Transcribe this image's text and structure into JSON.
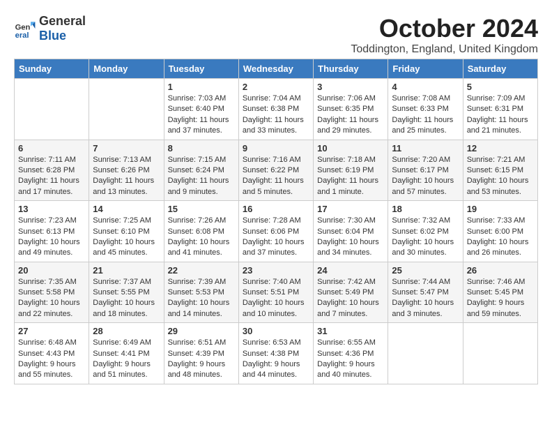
{
  "header": {
    "logo_general": "General",
    "logo_blue": "Blue",
    "title": "October 2024",
    "location": "Toddington, England, United Kingdom"
  },
  "days_of_week": [
    "Sunday",
    "Monday",
    "Tuesday",
    "Wednesday",
    "Thursday",
    "Friday",
    "Saturday"
  ],
  "weeks": [
    [
      {
        "day": "",
        "info": ""
      },
      {
        "day": "",
        "info": ""
      },
      {
        "day": "1",
        "info": "Sunrise: 7:03 AM\nSunset: 6:40 PM\nDaylight: 11 hours and 37 minutes."
      },
      {
        "day": "2",
        "info": "Sunrise: 7:04 AM\nSunset: 6:38 PM\nDaylight: 11 hours and 33 minutes."
      },
      {
        "day": "3",
        "info": "Sunrise: 7:06 AM\nSunset: 6:35 PM\nDaylight: 11 hours and 29 minutes."
      },
      {
        "day": "4",
        "info": "Sunrise: 7:08 AM\nSunset: 6:33 PM\nDaylight: 11 hours and 25 minutes."
      },
      {
        "day": "5",
        "info": "Sunrise: 7:09 AM\nSunset: 6:31 PM\nDaylight: 11 hours and 21 minutes."
      }
    ],
    [
      {
        "day": "6",
        "info": "Sunrise: 7:11 AM\nSunset: 6:28 PM\nDaylight: 11 hours and 17 minutes."
      },
      {
        "day": "7",
        "info": "Sunrise: 7:13 AM\nSunset: 6:26 PM\nDaylight: 11 hours and 13 minutes."
      },
      {
        "day": "8",
        "info": "Sunrise: 7:15 AM\nSunset: 6:24 PM\nDaylight: 11 hours and 9 minutes."
      },
      {
        "day": "9",
        "info": "Sunrise: 7:16 AM\nSunset: 6:22 PM\nDaylight: 11 hours and 5 minutes."
      },
      {
        "day": "10",
        "info": "Sunrise: 7:18 AM\nSunset: 6:19 PM\nDaylight: 11 hours and 1 minute."
      },
      {
        "day": "11",
        "info": "Sunrise: 7:20 AM\nSunset: 6:17 PM\nDaylight: 10 hours and 57 minutes."
      },
      {
        "day": "12",
        "info": "Sunrise: 7:21 AM\nSunset: 6:15 PM\nDaylight: 10 hours and 53 minutes."
      }
    ],
    [
      {
        "day": "13",
        "info": "Sunrise: 7:23 AM\nSunset: 6:13 PM\nDaylight: 10 hours and 49 minutes."
      },
      {
        "day": "14",
        "info": "Sunrise: 7:25 AM\nSunset: 6:10 PM\nDaylight: 10 hours and 45 minutes."
      },
      {
        "day": "15",
        "info": "Sunrise: 7:26 AM\nSunset: 6:08 PM\nDaylight: 10 hours and 41 minutes."
      },
      {
        "day": "16",
        "info": "Sunrise: 7:28 AM\nSunset: 6:06 PM\nDaylight: 10 hours and 37 minutes."
      },
      {
        "day": "17",
        "info": "Sunrise: 7:30 AM\nSunset: 6:04 PM\nDaylight: 10 hours and 34 minutes."
      },
      {
        "day": "18",
        "info": "Sunrise: 7:32 AM\nSunset: 6:02 PM\nDaylight: 10 hours and 30 minutes."
      },
      {
        "day": "19",
        "info": "Sunrise: 7:33 AM\nSunset: 6:00 PM\nDaylight: 10 hours and 26 minutes."
      }
    ],
    [
      {
        "day": "20",
        "info": "Sunrise: 7:35 AM\nSunset: 5:58 PM\nDaylight: 10 hours and 22 minutes."
      },
      {
        "day": "21",
        "info": "Sunrise: 7:37 AM\nSunset: 5:55 PM\nDaylight: 10 hours and 18 minutes."
      },
      {
        "day": "22",
        "info": "Sunrise: 7:39 AM\nSunset: 5:53 PM\nDaylight: 10 hours and 14 minutes."
      },
      {
        "day": "23",
        "info": "Sunrise: 7:40 AM\nSunset: 5:51 PM\nDaylight: 10 hours and 10 minutes."
      },
      {
        "day": "24",
        "info": "Sunrise: 7:42 AM\nSunset: 5:49 PM\nDaylight: 10 hours and 7 minutes."
      },
      {
        "day": "25",
        "info": "Sunrise: 7:44 AM\nSunset: 5:47 PM\nDaylight: 10 hours and 3 minutes."
      },
      {
        "day": "26",
        "info": "Sunrise: 7:46 AM\nSunset: 5:45 PM\nDaylight: 9 hours and 59 minutes."
      }
    ],
    [
      {
        "day": "27",
        "info": "Sunrise: 6:48 AM\nSunset: 4:43 PM\nDaylight: 9 hours and 55 minutes."
      },
      {
        "day": "28",
        "info": "Sunrise: 6:49 AM\nSunset: 4:41 PM\nDaylight: 9 hours and 51 minutes."
      },
      {
        "day": "29",
        "info": "Sunrise: 6:51 AM\nSunset: 4:39 PM\nDaylight: 9 hours and 48 minutes."
      },
      {
        "day": "30",
        "info": "Sunrise: 6:53 AM\nSunset: 4:38 PM\nDaylight: 9 hours and 44 minutes."
      },
      {
        "day": "31",
        "info": "Sunrise: 6:55 AM\nSunset: 4:36 PM\nDaylight: 9 hours and 40 minutes."
      },
      {
        "day": "",
        "info": ""
      },
      {
        "day": "",
        "info": ""
      }
    ]
  ]
}
